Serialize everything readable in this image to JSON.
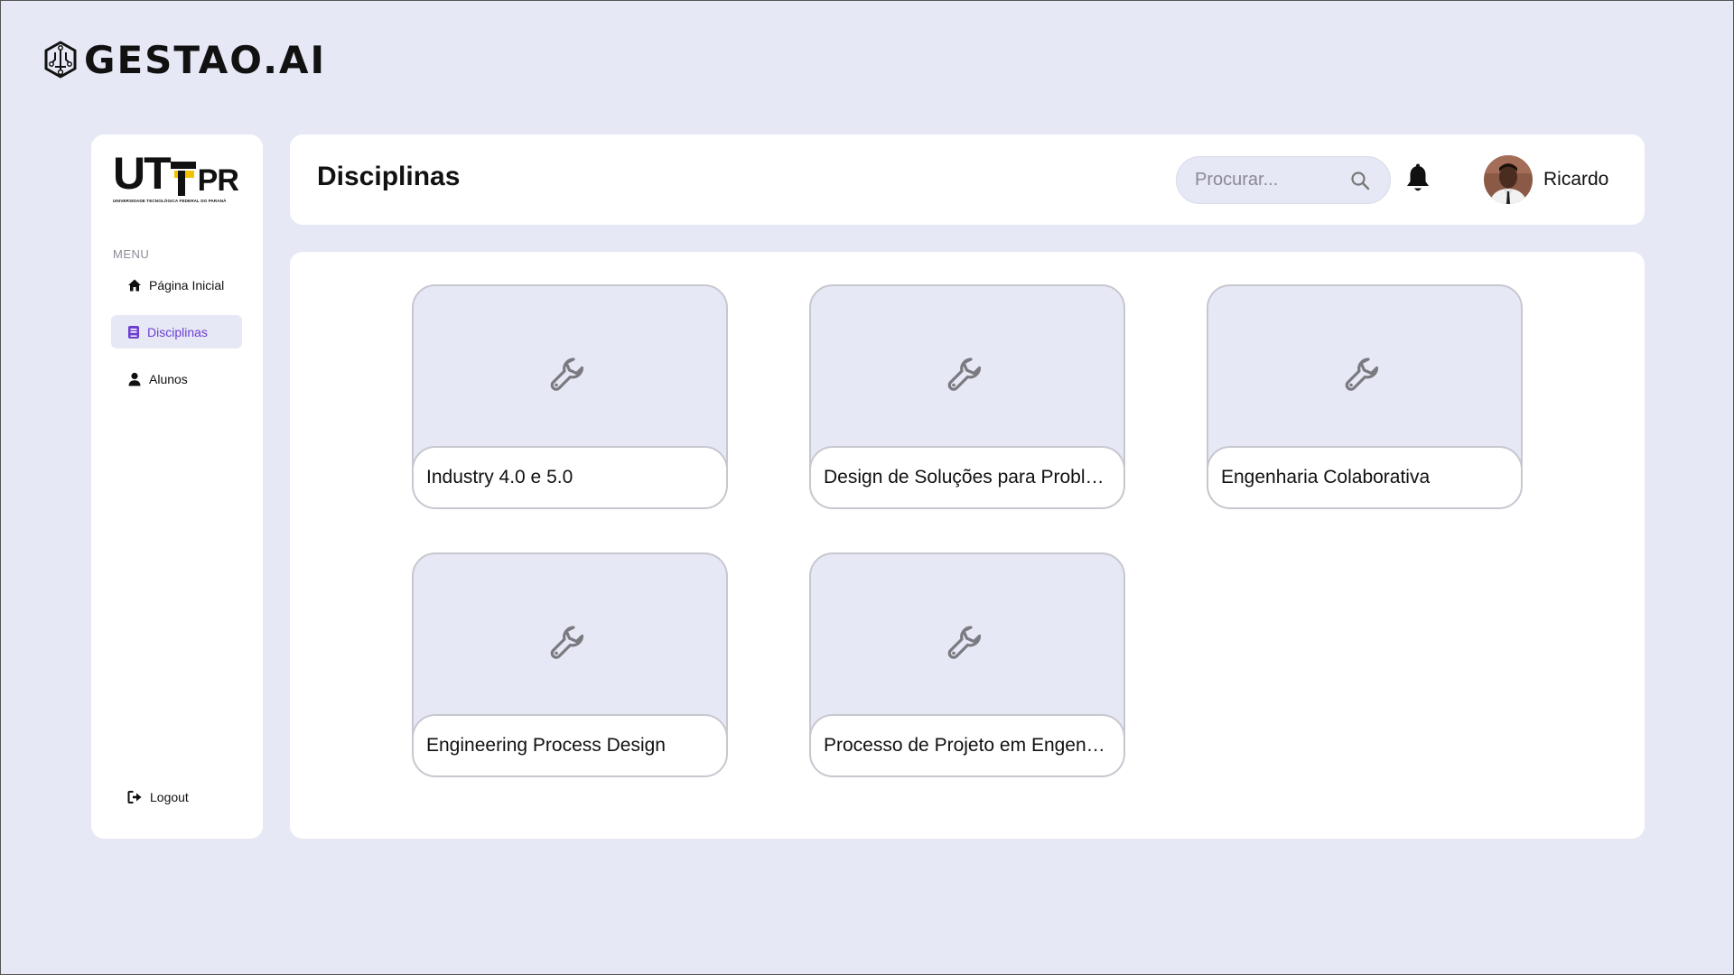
{
  "brand": {
    "name": "GESTAO.AI",
    "icon": "circuit-hexagon-icon"
  },
  "sidebar": {
    "logo": {
      "main_left": "UT",
      "main_right": "PR",
      "subtitle": "UNIVERSIDADE TECNOLÓGICA FEDERAL DO PARANÁ"
    },
    "menu_label": "MENU",
    "items": [
      {
        "label": "Página Inicial",
        "icon": "home-icon",
        "active": false
      },
      {
        "label": "Disciplinas",
        "icon": "book-icon",
        "active": true
      },
      {
        "label": "Alunos",
        "icon": "user-icon",
        "active": false
      }
    ],
    "logout_label": "Logout"
  },
  "header": {
    "title": "Disciplinas",
    "search_placeholder": "Procurar...",
    "user_name": "Ricardo"
  },
  "courses": [
    {
      "title": "Industry 4.0 e 5.0",
      "icon": "wrench-icon"
    },
    {
      "title": "Design de Soluções para Problem...",
      "icon": "wrench-icon"
    },
    {
      "title": "Engenharia Colaborativa",
      "icon": "wrench-icon"
    },
    {
      "title": "Engineering Process Design",
      "icon": "wrench-icon"
    },
    {
      "title": "Processo de Projeto em Engenhar...",
      "icon": "wrench-icon"
    }
  ],
  "colors": {
    "background": "#e6e8f5",
    "accent": "#6c3fd1",
    "logo_yellow": "#f2c200",
    "card_border": "#c7c7cf"
  }
}
